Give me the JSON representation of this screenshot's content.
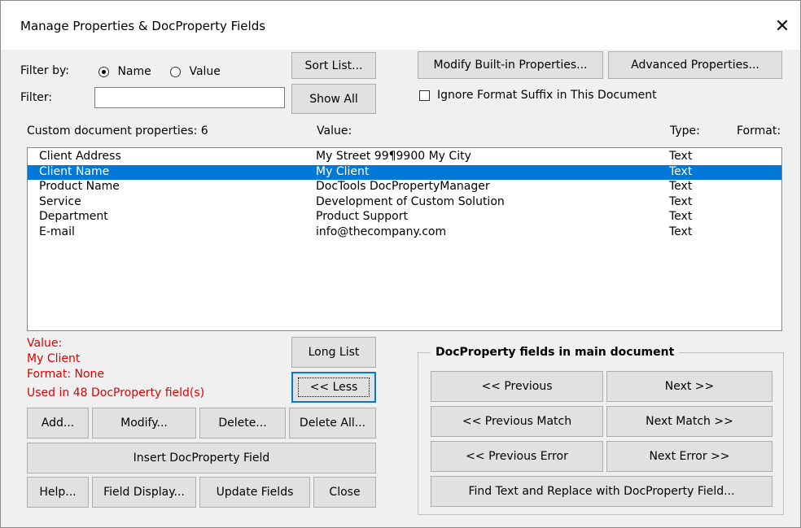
{
  "window": {
    "title": "Manage Properties & DocProperty Fields",
    "close_glyph": "✕"
  },
  "filter": {
    "label": "Filter by:",
    "name_option": "Name",
    "value_option": "Value",
    "selected": "Name",
    "filter_label": "Filter:",
    "filter_value": ""
  },
  "buttons": {
    "sort_list": "Sort List...",
    "show_all": "Show All",
    "modify_builtin": "Modify Built-in Properties...",
    "advanced": "Advanced Properties...",
    "long_list": "Long List",
    "less": "<< Less",
    "add": "Add...",
    "modify": "Modify...",
    "delete": "Delete...",
    "delete_all": "Delete All...",
    "insert_field": "Insert DocProperty Field",
    "help": "Help...",
    "field_display": "Field Display...",
    "update_fields": "Update Fields",
    "close": "Close"
  },
  "ignore_format": {
    "label": "Ignore Format Suffix in This Document",
    "checked": false
  },
  "list": {
    "header_name": "Custom document properties:  6",
    "header_value": "Value:",
    "header_type": "Type:",
    "header_format": "Format:",
    "selected_index": 1,
    "rows": [
      {
        "name": "Client Address",
        "value": "My Street 99¶9900 My City",
        "type": "Text"
      },
      {
        "name": "Client Name",
        "value": "My Client",
        "type": "Text"
      },
      {
        "name": "Product Name",
        "value": "DocTools DocPropertyManager",
        "type": "Text"
      },
      {
        "name": "Service",
        "value": "Development of Custom Solution",
        "type": "Text"
      },
      {
        "name": "Department",
        "value": "Product Support",
        "type": "Text"
      },
      {
        "name": "E-mail",
        "value": "info@thecompany.com",
        "type": "Text"
      }
    ]
  },
  "info": {
    "value_label": "Value:",
    "value": "My Client",
    "format": "Format: None",
    "usage": "Used in 48 DocProperty field(s)"
  },
  "nav": {
    "group_title": "DocProperty fields in main document",
    "previous": "<< Previous",
    "next": "Next >>",
    "previous_match": "<< Previous Match",
    "next_match": "Next Match >>",
    "previous_error": "<< Previous Error",
    "next_error": "Next Error >>",
    "find_replace": "Find Text and Replace with DocProperty Field..."
  },
  "colors": {
    "selection": "#0078d7",
    "info_text": "#e00000"
  }
}
